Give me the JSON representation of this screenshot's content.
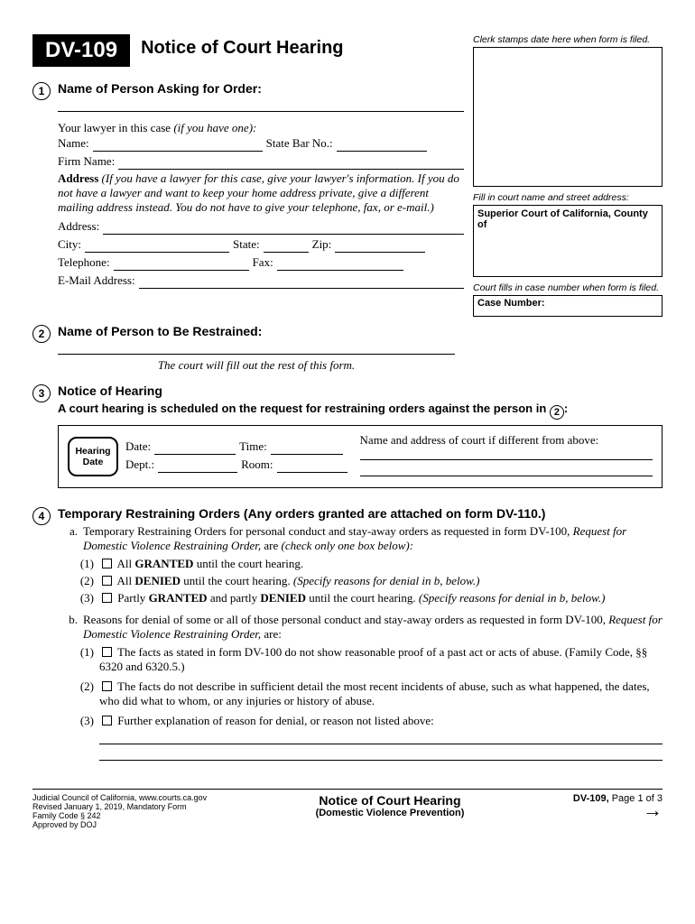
{
  "header": {
    "form_number": "DV-109",
    "title": "Notice of Court Hearing"
  },
  "right": {
    "stamp_note": "Clerk stamps date here when form is filed.",
    "court_note": "Fill in court name and street address:",
    "court_label": "Superior Court of California, County of",
    "case_note": "Court fills in case number when form is filed.",
    "case_label": "Case Number:"
  },
  "s1": {
    "title": "Name of Person Asking for Order:",
    "lawyer_intro": "Your lawyer in this case (if you have one):",
    "name_label": "Name:",
    "bar_label": "State Bar No.:",
    "firm_label": "Firm Name:",
    "address_head": "Address",
    "address_note": " (If you have a lawyer for this case, give your lawyer's information. If you do not have a lawyer and want to keep your home address private, give a different mailing address instead. You do not have to give your telephone, fax, or e-mail.)",
    "address_label": "Address:",
    "city_label": "City:",
    "state_label": "State:",
    "zip_label": "Zip:",
    "tel_label": "Telephone:",
    "fax_label": "Fax:",
    "email_label": "E-Mail Address:"
  },
  "s2": {
    "title": "Name of Person to Be Restrained:",
    "note": "The court will fill out the rest of this form."
  },
  "s3": {
    "title": "Notice of Hearing",
    "sched_prefix": "A court hearing is scheduled on the request for restraining orders against the person in",
    "sched_ref": "2",
    "sched_suffix": ":",
    "diff_label": "Name and address of court if different from above:",
    "badge1": "Hearing",
    "badge2": "Date",
    "date": "Date:",
    "time": "Time:",
    "dept": "Dept.:",
    "room": "Room:"
  },
  "s4": {
    "title": "Temporary Restraining Orders (Any orders granted are attached on form DV-110.)",
    "a_intro_1": "Temporary Restraining Orders for personal conduct and stay-away orders as requested in form DV-100,  ",
    "a_intro_ital1": "Request for Domestic Violence Restraining Order,",
    "a_intro_2": " are ",
    "a_intro_ital2": "(check only one box below):",
    "a1_pre": "All ",
    "a1_bold": "GRANTED",
    "a1_post": " until the court hearing.",
    "a2_pre": "All ",
    "a2_bold": "DENIED",
    "a2_post": " until the court hearing. ",
    "a2_ital": "(Specify reasons for denial in b, below.)",
    "a3_pre": "Partly ",
    "a3_bold1": "GRANTED",
    "a3_mid": " and partly ",
    "a3_bold2": "DENIED",
    "a3_post": " until the court hearing. ",
    "a3_ital": "(Specify reasons for denial in b, below.)",
    "b_intro_1": "Reasons for denial of some or all of those personal conduct and stay-away orders as requested in form DV-100, ",
    "b_intro_ital": "Request for Domestic Violence Restraining Order,",
    "b_intro_2": " are:",
    "b1": "The facts as stated in form DV-100 do not show reasonable proof of a past act or acts of abuse. (Family Code, §§ 6320 and 6320.5.)",
    "b2": "The facts do not describe in sufficient detail the most recent incidents of abuse, such as what happened, the dates, who did what to whom, or any injuries or history of abuse.",
    "b3": "Further explanation of reason for denial, or reason not listed above:"
  },
  "footer": {
    "l1": "Judicial Council of California, www.courts.ca.gov",
    "l2": "Revised January 1, 2019, Mandatory Form",
    "l3": "Family Code  § 242",
    "l4": "Approved by DOJ",
    "center_title": "Notice of Court Hearing",
    "center_sub": "(Domestic Violence Prevention)",
    "right": "DV-109, ",
    "page": "Page 1 of 3"
  }
}
